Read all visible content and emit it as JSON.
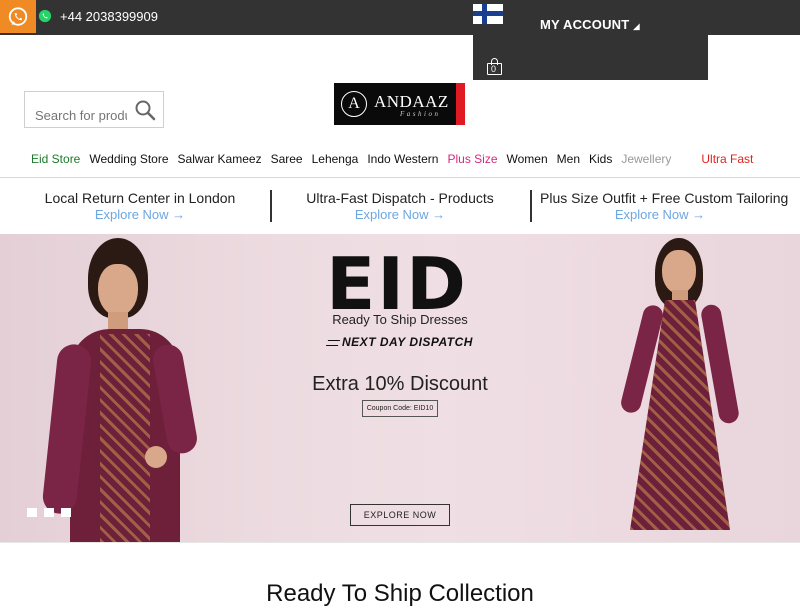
{
  "topbar": {
    "phone": "+44 2038399909",
    "account_label": "MY ACCOUNT",
    "cart_count": "0",
    "icons": [
      "whatsapp-icon",
      "finland-flag-icon",
      "cart-icon"
    ]
  },
  "header": {
    "search_placeholder": "Search for products",
    "logo": {
      "letter": "A",
      "brand": "ANDAAZ",
      "tagline": "Fashion"
    }
  },
  "nav": {
    "items": [
      {
        "label": "Eid Store",
        "color": "#1d7a2b"
      },
      {
        "label": "Wedding Store"
      },
      {
        "label": "Salwar Kameez"
      },
      {
        "label": "Saree"
      },
      {
        "label": "Lehenga"
      },
      {
        "label": "Indo Western"
      },
      {
        "label": "Plus Size",
        "color": "#d6287d"
      },
      {
        "label": "Women"
      },
      {
        "label": "Men"
      },
      {
        "label": "Kids"
      },
      {
        "label": "Jewellery",
        "color": "#999999"
      },
      {
        "label": "Ultra Fast",
        "color": "#e0231e"
      }
    ]
  },
  "promos": [
    {
      "title": "Local Return Center in London",
      "link": "Explore Now →"
    },
    {
      "title": "Ultra-Fast Dispatch - Products",
      "link": "Explore Now →"
    },
    {
      "title": "Plus Size Outfit + Free Custom Tailoring",
      "link": "Explore Now →"
    }
  ],
  "hero": {
    "headline": "EID",
    "subline": "Ready To Ship Dresses",
    "dispatch": "NEXT DAY DISPATCH",
    "discount": "Extra 10% Discount",
    "coupon": "Coupon Code: EID10",
    "button": "EXPLORE NOW",
    "slides": 3,
    "accent_color": "#6e1f3a"
  },
  "section": {
    "title": "Ready To Ship Collection"
  }
}
